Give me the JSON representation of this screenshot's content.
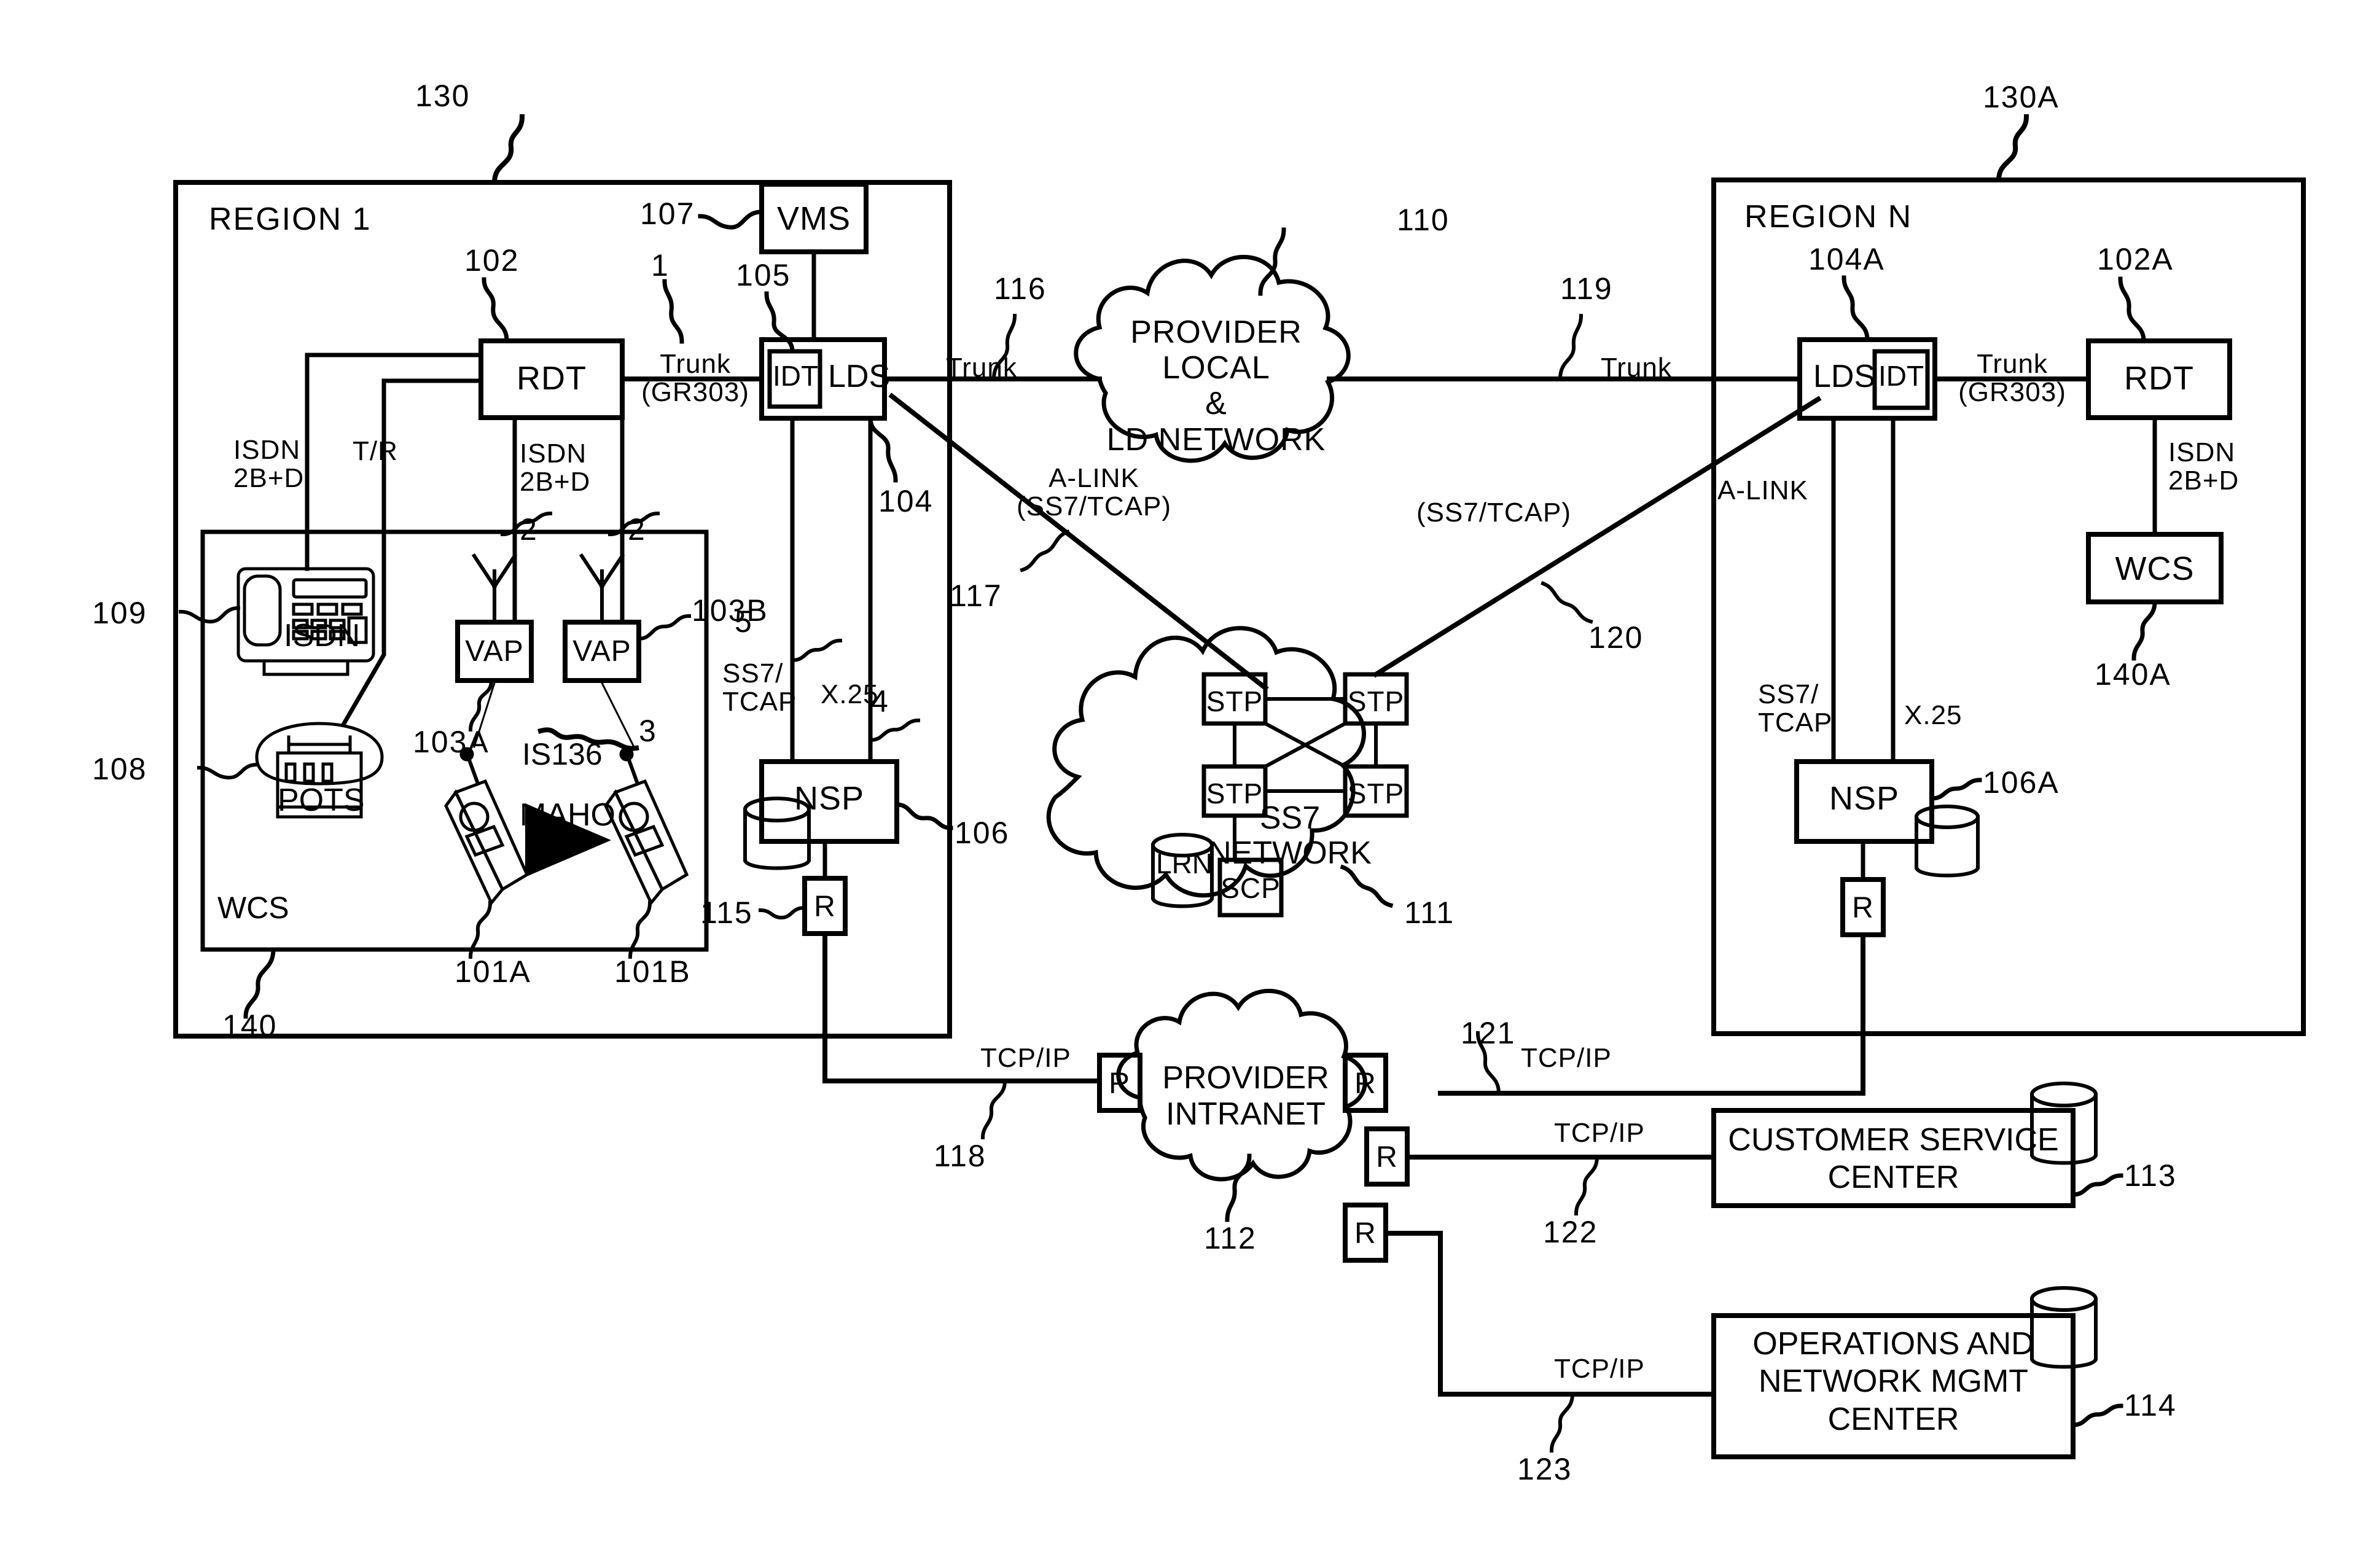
{
  "figure": {
    "type": "patent-network-diagram",
    "title": "Telecommunications network architecture diagram"
  },
  "regions": [
    {
      "id": "region1",
      "label": "REGION 1",
      "ref": "130"
    },
    {
      "id": "regionN",
      "label": "REGION N",
      "ref": "130A"
    }
  ],
  "clouds": [
    {
      "id": "provider_ld",
      "lines": [
        "PROVIDER LOCAL",
        "&",
        "LD NETWORK"
      ],
      "ref": "110"
    },
    {
      "id": "ss7",
      "lines": [
        "SS7",
        "NETWORK"
      ],
      "ref": "111"
    },
    {
      "id": "intranet",
      "lines": [
        "PROVIDER",
        "INTRANET"
      ],
      "ref": "112"
    }
  ],
  "boxes": [
    {
      "id": "vms",
      "label": "VMS",
      "ref": "107"
    },
    {
      "id": "rdt1",
      "label": "RDT",
      "ref": "102"
    },
    {
      "id": "idt1",
      "label": "IDT",
      "ref": "105"
    },
    {
      "id": "lds1",
      "label": "LDS",
      "ref": "104"
    },
    {
      "id": "vap_a",
      "label": "VAP",
      "ref": "103A"
    },
    {
      "id": "vap_b",
      "label": "VAP",
      "ref": "103B"
    },
    {
      "id": "nsp1",
      "label": "NSP",
      "ref": "106"
    },
    {
      "id": "router1",
      "label": "R",
      "ref": "115"
    },
    {
      "id": "lds_n",
      "label": "LDS",
      "ref": "104A"
    },
    {
      "id": "idt_n",
      "label": "IDT",
      "ref": ""
    },
    {
      "id": "rdt_n",
      "label": "RDT",
      "ref": "102A"
    },
    {
      "id": "wcs_n",
      "label": "WCS",
      "ref": "140A"
    },
    {
      "id": "nsp_n",
      "label": "NSP",
      "ref": "106A"
    },
    {
      "id": "router_n",
      "label": "R",
      "ref": ""
    },
    {
      "id": "stp1",
      "label": "STP",
      "ref": ""
    },
    {
      "id": "stp2",
      "label": "STP",
      "ref": ""
    },
    {
      "id": "stp3",
      "label": "STP",
      "ref": ""
    },
    {
      "id": "stp4",
      "label": "STP",
      "ref": ""
    },
    {
      "id": "scp",
      "label": "SCP",
      "ref": ""
    },
    {
      "id": "lrn_db",
      "label": "LRN",
      "ref": ""
    },
    {
      "id": "csc",
      "lines": [
        "CUSTOMER SERVICE",
        "CENTER"
      ],
      "ref": "113"
    },
    {
      "id": "onmc",
      "lines": [
        "OPERATIONS AND",
        "NETWORK MGMT",
        "CENTER"
      ],
      "ref": "114"
    },
    {
      "id": "router_in",
      "label": "R",
      "ref": ""
    },
    {
      "id": "router_out1",
      "label": "R",
      "ref": ""
    },
    {
      "id": "router_out2",
      "label": "R",
      "ref": ""
    },
    {
      "id": "router_out3",
      "label": "R",
      "ref": ""
    }
  ],
  "devices": [
    {
      "id": "isdn_phone",
      "label": "ISDN",
      "ref": "109"
    },
    {
      "id": "pots_phone",
      "label": "POTS",
      "ref": "108"
    },
    {
      "id": "handset_a",
      "label": "",
      "ref": "101A"
    },
    {
      "id": "handset_b",
      "label": "",
      "ref": "101B"
    },
    {
      "id": "wcs_group",
      "label": "WCS",
      "ref": "140"
    }
  ],
  "link_labels": {
    "isdn_2bd_left": "ISDN\n2B+D",
    "tr": "T/R",
    "isdn_2bd_mid": "ISDN\n2B+D",
    "trunk_gr303_1": "Trunk\n(GR303)",
    "trunk_116": "Trunk",
    "trunk_119": "Trunk",
    "trunk_gr303_n": "Trunk\n(GR303)",
    "isdn_2bd_n": "ISDN\n2B+D",
    "alink_left": "A-LINK\n(SS7/TCAP)",
    "alink_right": "A-LINK",
    "ss7tcap_right_paren": "(SS7/TCAP)",
    "ss7_tcap_1": "SS7/\nTCAP",
    "x25_1": "X.25",
    "ss7_tcap_n": "SS7/\nTCAP",
    "x25_n": "X.25",
    "tcpip_118": "TCP/IP",
    "tcpip_121": "TCP/IP",
    "tcpip_122": "TCP/IP",
    "tcpip_123": "TCP/IP",
    "is136": "IS136",
    "maho": "MAHO"
  },
  "numeric_callouts": {
    "n1": "1",
    "n2a": "2",
    "n2b": "2",
    "n3": "3",
    "n4": "4",
    "n5": "5"
  },
  "reference_numerals": [
    "130",
    "130A",
    "107",
    "102",
    "105",
    "104",
    "103A",
    "103B",
    "106",
    "115",
    "101A",
    "101B",
    "108",
    "109",
    "110",
    "111",
    "112",
    "113",
    "114",
    "116",
    "117",
    "118",
    "119",
    "120",
    "121",
    "122",
    "123",
    "140",
    "140A",
    "102A",
    "104A",
    "106A"
  ],
  "colors": {
    "stroke": "#000000",
    "background": "#ffffff"
  }
}
